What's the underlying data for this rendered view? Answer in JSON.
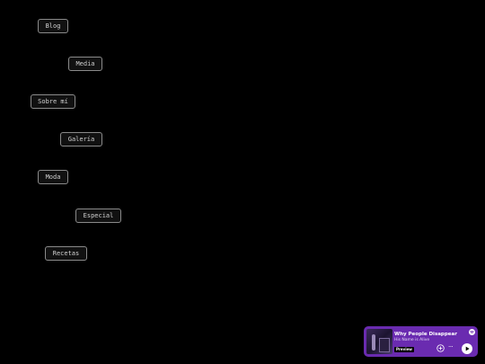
{
  "nav": {
    "blog": "Blog",
    "media": "Media",
    "about": "Sobre mí",
    "gallery": "Galería",
    "fashion": "Moda",
    "special": "Especial",
    "recipes": "Recetas"
  },
  "player": {
    "track_title": "Why People Disappear",
    "artist": "His Name is Alive",
    "preview_label": "Preview",
    "more_label": "···",
    "brand_color": "#6a2bb0",
    "icons": [
      "spotify-logo-icon",
      "add-circle-icon",
      "more-icon",
      "play-icon"
    ]
  }
}
